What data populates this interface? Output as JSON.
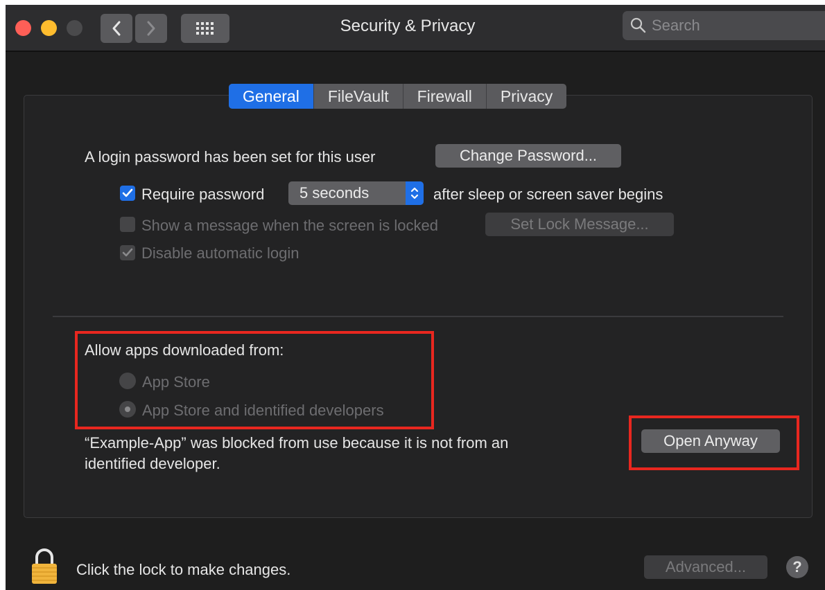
{
  "window": {
    "title": "Security & Privacy",
    "search_placeholder": "Search"
  },
  "tabs": [
    {
      "label": "General",
      "active": true
    },
    {
      "label": "FileVault",
      "active": false
    },
    {
      "label": "Firewall",
      "active": false
    },
    {
      "label": "Privacy",
      "active": false
    }
  ],
  "general": {
    "login_password_text": "A login password has been set for this user",
    "change_password_label": "Change Password...",
    "require_password_label": "Require password",
    "require_password_checked": true,
    "require_password_delay": "5 seconds",
    "after_sleep_text": "after sleep or screen saver begins",
    "show_message_label": "Show a message when the screen is locked",
    "set_lock_message_label": "Set Lock Message...",
    "disable_auto_login_label": "Disable automatic login"
  },
  "downloads": {
    "heading": "Allow apps downloaded from:",
    "options": [
      {
        "label": "App Store",
        "selected": false
      },
      {
        "label": "App Store and identified developers",
        "selected": true
      }
    ],
    "blocked_message_line1": "“Example-App” was blocked from use because it is not from an",
    "blocked_message_line2": "identified developer.",
    "open_anyway_label": "Open Anyway"
  },
  "footer": {
    "lock_text": "Click the lock to make changes.",
    "advanced_label": "Advanced...",
    "help_label": "?"
  },
  "colors": {
    "accent": "#1f6fe6",
    "annotation": "#e8271f"
  }
}
